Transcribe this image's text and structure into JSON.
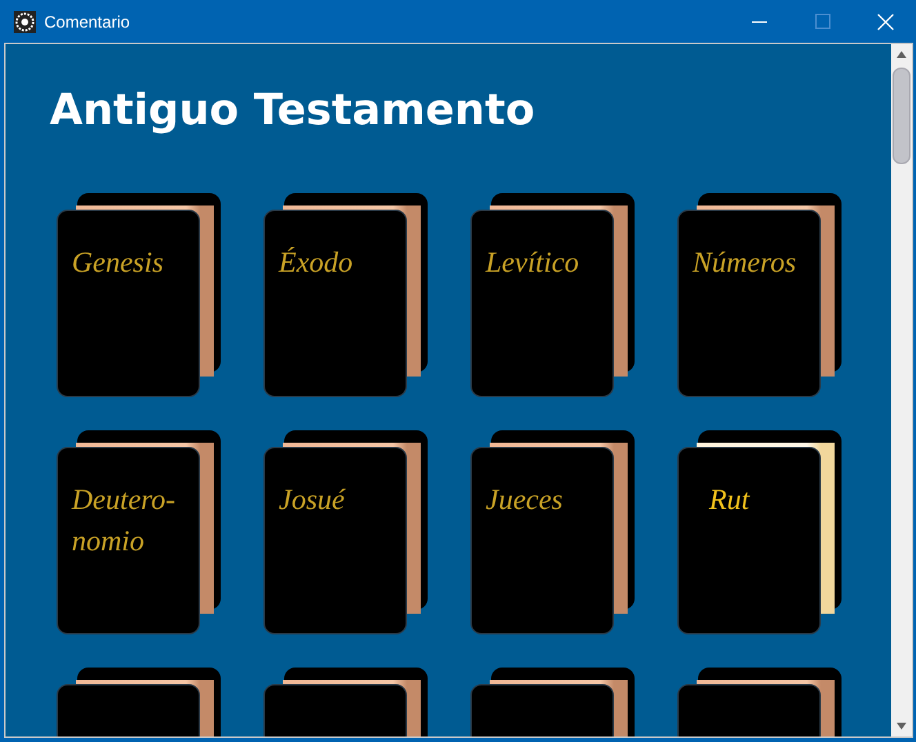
{
  "window": {
    "title": "Comentario"
  },
  "heading": "Antiguo Testamento",
  "books": [
    {
      "title": "Genesis",
      "selected": false
    },
    {
      "title": "Éxodo",
      "selected": false
    },
    {
      "title": "Levítico",
      "selected": false
    },
    {
      "title": "Números",
      "selected": false
    },
    {
      "title": "Deutero-nomio",
      "selected": false
    },
    {
      "title": "Josué",
      "selected": false
    },
    {
      "title": "Jueces",
      "selected": false
    },
    {
      "title": "Rut",
      "selected": true
    },
    {
      "selected": false
    },
    {
      "selected": false
    },
    {
      "selected": false
    },
    {
      "selected": false
    }
  ]
}
